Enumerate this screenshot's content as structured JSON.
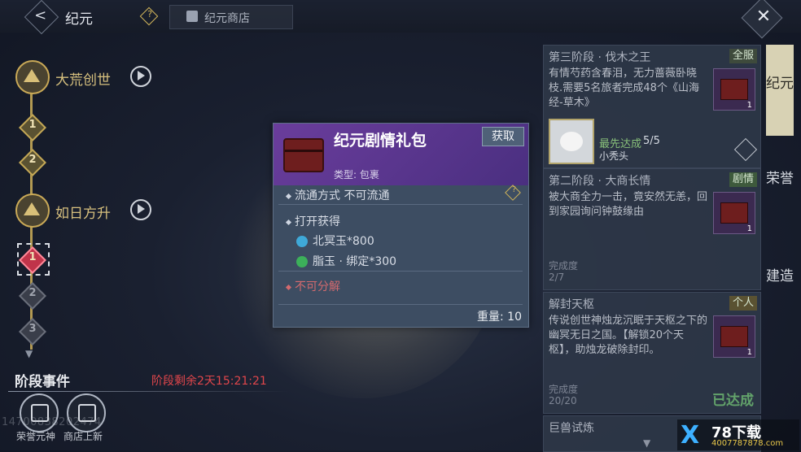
{
  "header": {
    "back_glyph": "<",
    "title": "纪元",
    "help_glyph": "?",
    "shop_tab": "纪元商店",
    "close_glyph": "✕"
  },
  "timeline": {
    "eras": [
      {
        "label": "大荒创世"
      },
      {
        "label": "如日方升"
      }
    ],
    "nodes_era1": [
      "1",
      "2"
    ],
    "nodes_era2": [
      "1",
      "2",
      "3"
    ]
  },
  "stage_events": {
    "title": "阶段事件",
    "remaining": "阶段剩余2天15:21:21",
    "shortcuts": [
      {
        "label": "荣誉元神",
        "icon": "honor-spirit-icon"
      },
      {
        "label": "商店上新",
        "icon": "shop-new-icon"
      }
    ],
    "faint_id": "14700838202474"
  },
  "popup": {
    "name": "纪元剧情礼包",
    "acquire": "获取",
    "type": "类型: 包裹",
    "circulation": "流通方式   不可流通",
    "open_obtain": "打开获得",
    "rewards": [
      {
        "text": "北冥玉*800",
        "color": "#3fa9d8",
        "icon": "beiming-jade-icon"
      },
      {
        "text": "脂玉 · 绑定*300",
        "color": "#3cb05a",
        "icon": "zhi-jade-icon"
      }
    ],
    "non_decomposable": "不可分解",
    "weight": "重量: 10"
  },
  "cards": [
    {
      "title": "第三阶段 · 伐木之王",
      "tag": "全服",
      "desc": "有情芍药含春泪，无力蔷薇卧晓枝.需要5名旅者完成48个《山海经-草木》",
      "item_count": "1",
      "first_reach": "最先达成",
      "first_count": "5/5",
      "first_name": "小秃头"
    },
    {
      "title": "第二阶段 · 大商长情",
      "tag": "剧情",
      "desc": "被大商全力一击，竟安然无恙，回到家园询问钟鼓缘由",
      "item_count": "1",
      "progress_label": "完成度",
      "progress_value": "2/7"
    },
    {
      "title": "解封天枢",
      "tag": "个人",
      "desc": "传说创世神烛龙沉眠于天枢之下的幽冥无日之国。【解锁20个天枢】，助烛龙破除封印。",
      "item_count": "1",
      "progress_label": "完成度",
      "progress_value": "20/20",
      "reached": "已达成"
    },
    {
      "title": "巨兽试炼"
    }
  ],
  "side_tabs": [
    "纪元",
    "荣誉",
    "建造"
  ],
  "watermark": {
    "x": "X",
    "brand": "78下载",
    "url": "4007787878.com"
  },
  "colors": {
    "accent_gold": "#c9a957",
    "red_text": "#e0464b",
    "green_reached": "#62a26a",
    "popup_purple": "#6a3d9c"
  }
}
